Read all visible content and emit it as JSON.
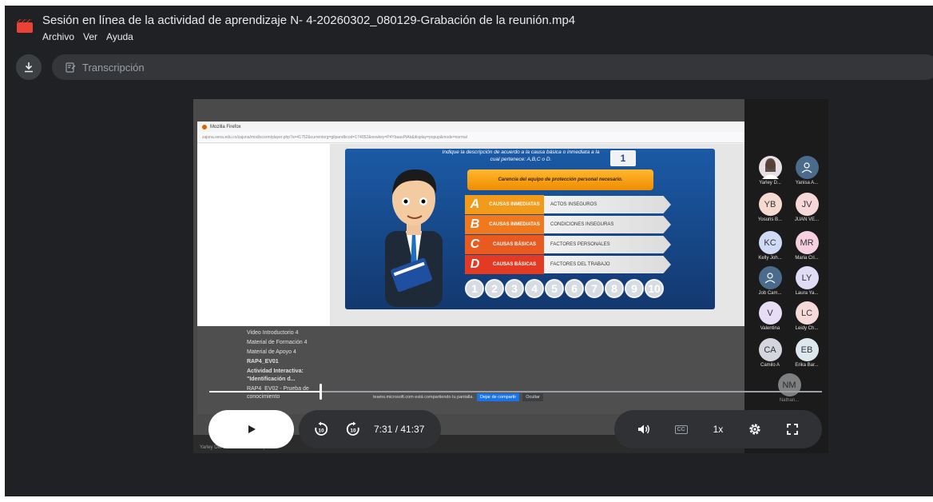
{
  "window": {
    "title": "Sesión en línea de la actividad de aprendizaje N- 4-20260302_080129-Grabación de la reunión.mp4",
    "menu": [
      "Archivo",
      "Ver",
      "Ayuda"
    ]
  },
  "toolbar": {
    "transcript_label": "Transcripción"
  },
  "shared_screen": {
    "browser_title": "Mozilla Firefox",
    "url": "zajuna.sena.edu.co/zajuna/mod/scorm/player.php?a=41752&currentorg=gilpandbcod=174052&newkey=P4YbaasPtAk&display=popup&mode=normal",
    "question": "Indique la descripción de acuerdo a la causa básica o inmediata a la cual pertenece: A,B,C o D.",
    "question_number": "1",
    "prompt": "Carencia del equipo de protección personal necesario.",
    "options": [
      {
        "letter": "A",
        "category": "CAUSAS INMEDIATAS",
        "description": "ACTOS INSEGUROS",
        "color": "#f29a1a"
      },
      {
        "letter": "B",
        "category": "CAUSAS INMEDIATAS",
        "description": "CONDICIONES INSEGURAS",
        "color": "#f0781e"
      },
      {
        "letter": "C",
        "category": "CAUSAS BÁSICAS",
        "description": "FACTORES PERSONALES",
        "color": "#e95a21"
      },
      {
        "letter": "D",
        "category": "CAUSAS BÁSICAS",
        "description": "FACTORES DEL TRABAJO",
        "color": "#e23a23"
      }
    ],
    "numbers": [
      "1",
      "2",
      "3",
      "4",
      "5",
      "6",
      "7",
      "8",
      "9",
      "10"
    ],
    "course_items": [
      "Video Introductorio 4",
      "Material de Formación 4",
      "Material de Apoyo 4",
      "RAP4_EV01",
      "Actividad Interactiva: \"Identificación d...",
      "RAP4_EV02 - Prueba de conocimiento"
    ],
    "share_notice": "teams.microsoft.com está compartiendo tu pantalla.",
    "stop_share": "Dejar de compartir",
    "hide_share": "Ocultar",
    "presenter": "Yarley Del Carmen Jaraba Rojas"
  },
  "participants": [
    {
      "initials": "",
      "name": "Yarley D...",
      "color": "#e7dfe4",
      "photo": true
    },
    {
      "initials": "",
      "name": "Yanisa A...",
      "color": "#4a6b8c",
      "generic": true
    },
    {
      "initials": "YB",
      "name": "Yosuris B...",
      "color": "#f6d9d1"
    },
    {
      "initials": "JV",
      "name": "JUAN VE...",
      "color": "#f7d8d8"
    },
    {
      "initials": "KC",
      "name": "Kelly Joh...",
      "color": "#cfdaf6"
    },
    {
      "initials": "MR",
      "name": "Maria Cri...",
      "color": "#f6cfe0"
    },
    {
      "initials": "",
      "name": "Job Cam...",
      "color": "#4a6b8c",
      "generic": true
    },
    {
      "initials": "LY",
      "name": "Laura Ya...",
      "color": "#e0dcf6"
    },
    {
      "initials": "V",
      "name": "Valentina",
      "color": "#e8ddf7"
    },
    {
      "initials": "LC",
      "name": "Leidy Ch...",
      "color": "#f6dada"
    },
    {
      "initials": "CA",
      "name": "Camilo A",
      "color": "#d3d6dc"
    },
    {
      "initials": "EB",
      "name": "Erika Bar...",
      "color": "#dde7ee"
    },
    {
      "initials": "NM",
      "name": "Nathan...",
      "color": "#cfd2d6"
    }
  ],
  "player": {
    "current_time": "7:31",
    "duration": "/ 41:37",
    "progress": 0.181,
    "rewind_label": "10",
    "forward_label": "10",
    "cc_label": "CC",
    "speed_label": "1x"
  }
}
